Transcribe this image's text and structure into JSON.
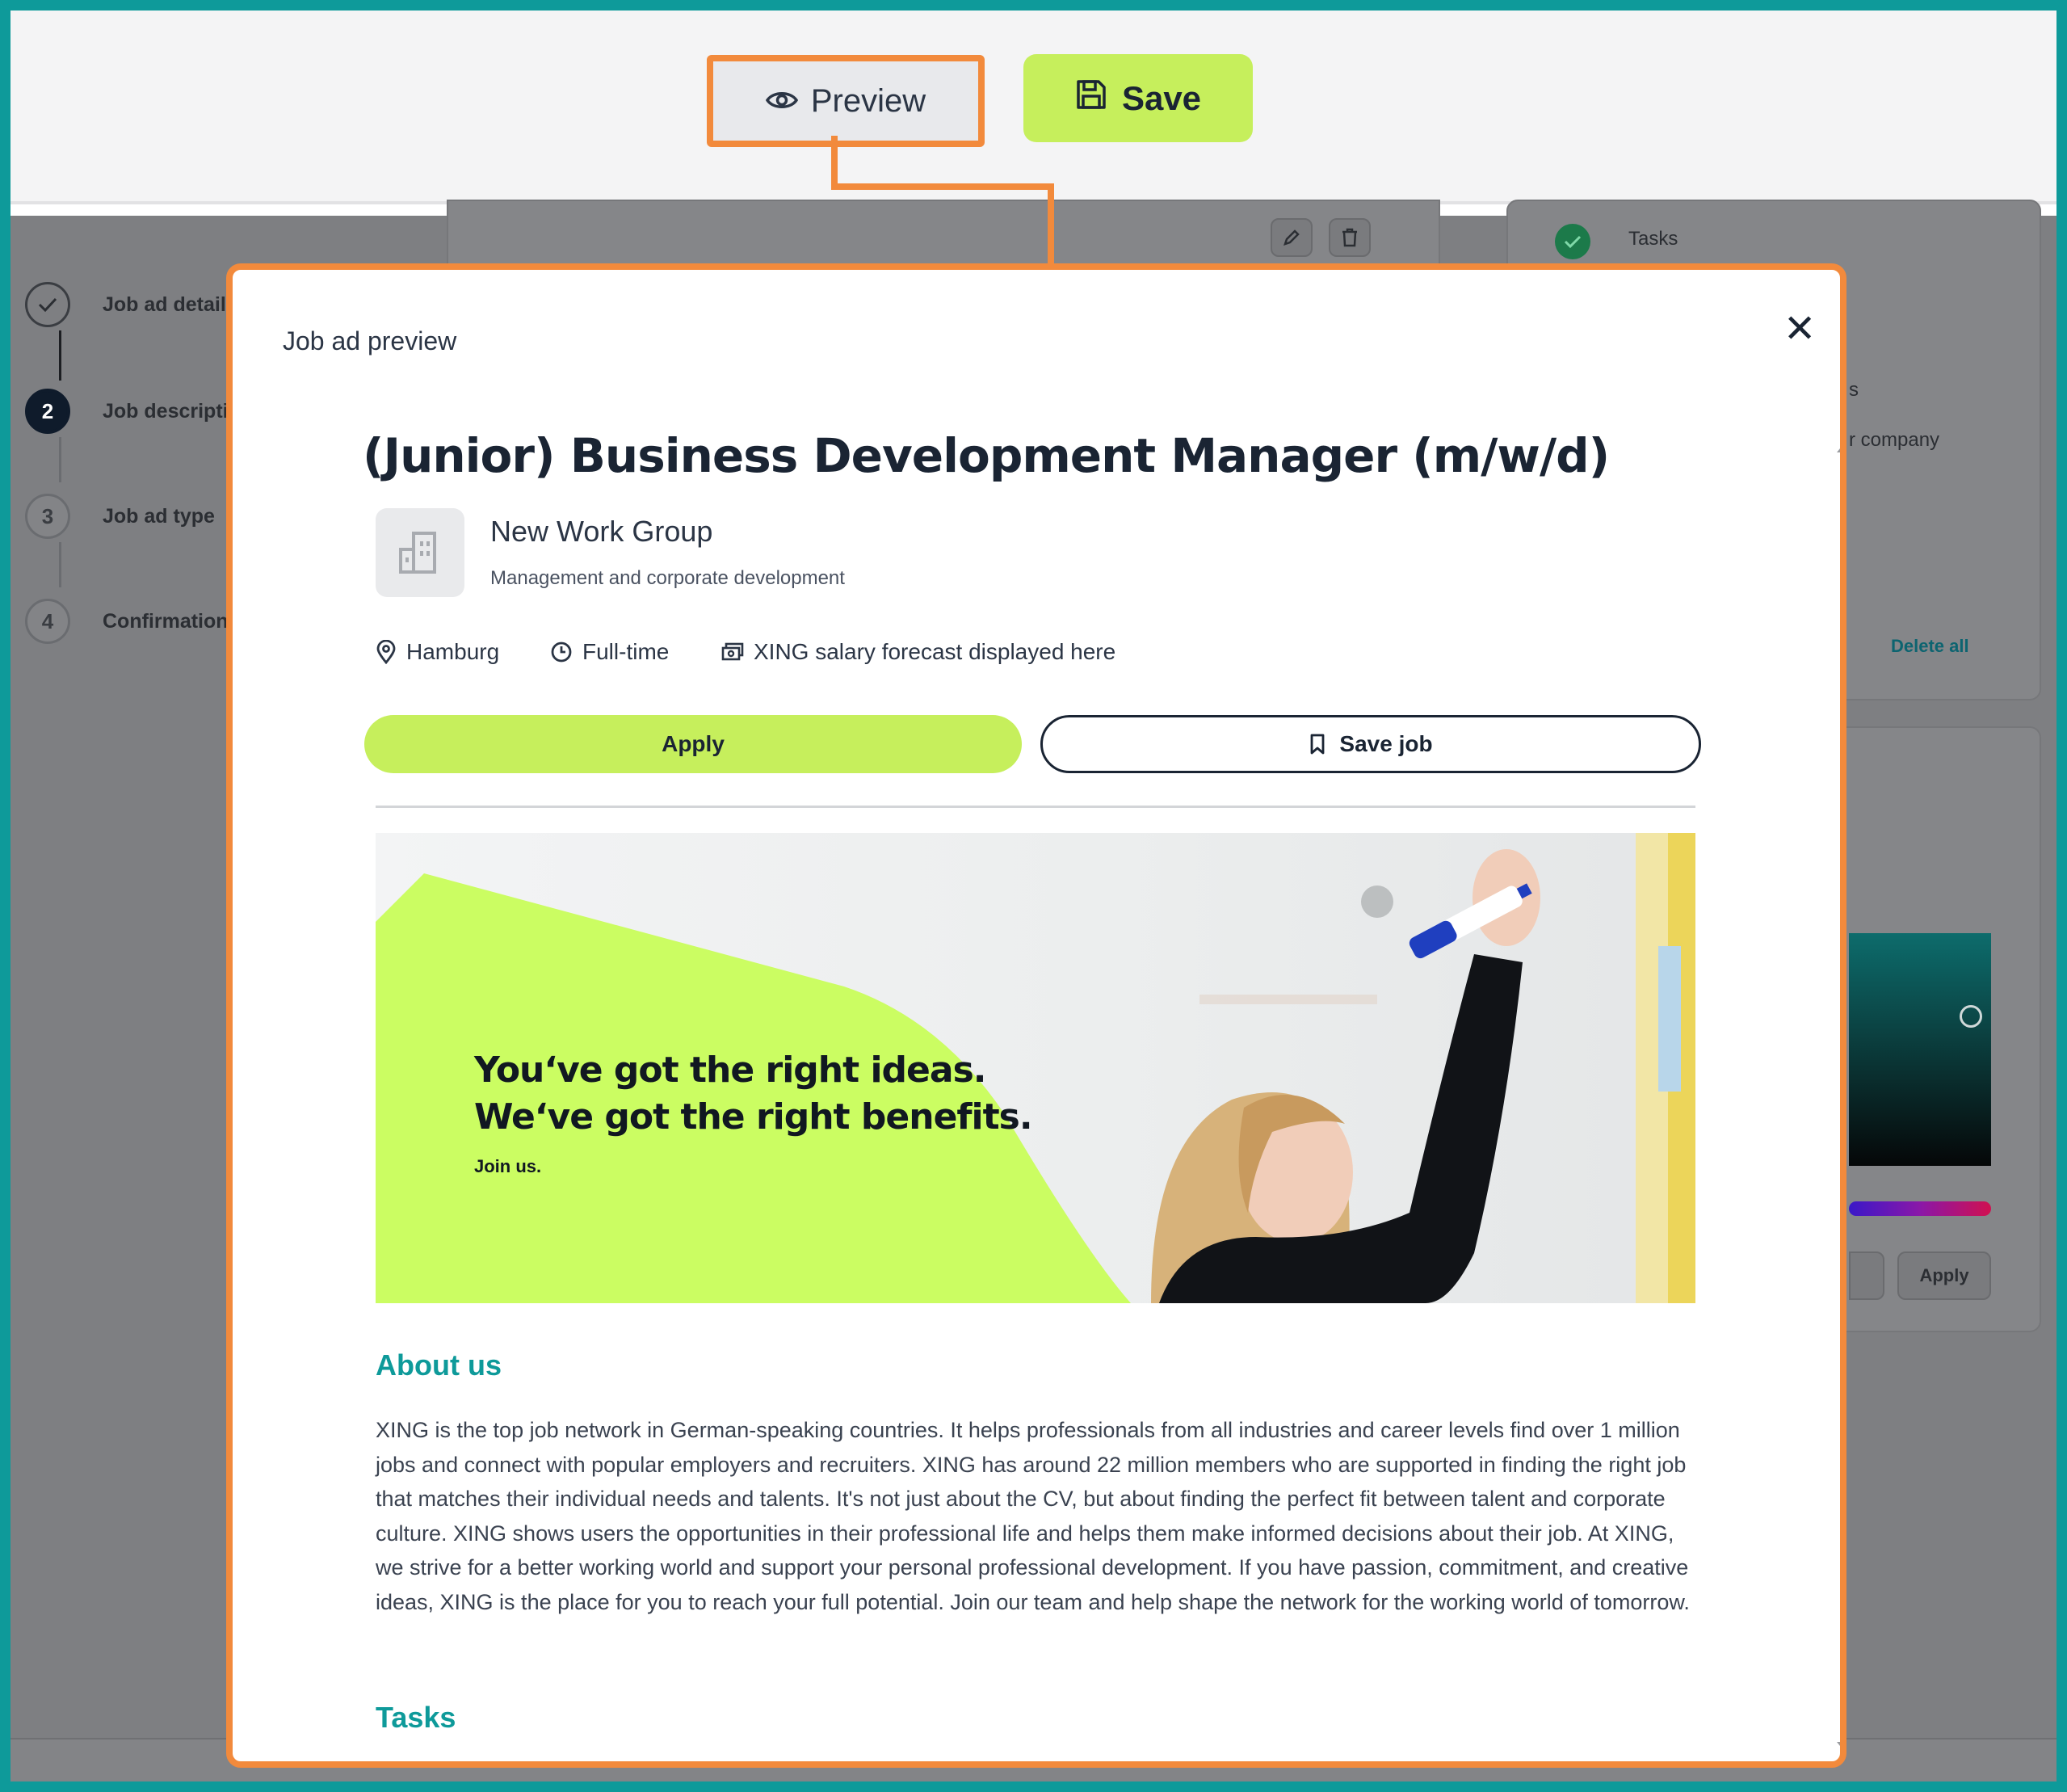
{
  "toolbar": {
    "preview_label": "Preview",
    "save_label": "Save"
  },
  "background_app": {
    "steps": [
      {
        "number": "✓",
        "label": "Job ad details"
      },
      {
        "number": "2",
        "label": "Job descriptio"
      },
      {
        "number": "3",
        "label": "Job ad type"
      },
      {
        "number": "4",
        "label": "Confirmation"
      }
    ],
    "right_panel": {
      "tasks_label": "Tasks",
      "partial_s": "s",
      "partial_company": "r company",
      "delete_all": "Delete all",
      "apply_label": "Apply"
    }
  },
  "modal": {
    "title": "Job ad preview",
    "close_glyph": "✕",
    "job": {
      "title": "(Junior) Business Development Manager (m/w/d)",
      "company_name": "New Work Group",
      "company_category": "Management and corporate development",
      "location": "Hamburg",
      "employment_type": "Full-time",
      "salary": "XING salary forecast displayed here",
      "apply_label": "Apply",
      "save_job_label": "Save job"
    },
    "banner": {
      "headline_line1": "You‘ve got the right ideas.",
      "headline_line2": "We‘ve got the right benefits.",
      "subline": "Join us."
    },
    "about": {
      "heading": "About us",
      "text": "XING is the top job network in German-speaking countries. It helps professionals from all industries and career levels find over 1 million jobs and connect with popular employers and recruiters. XING has around 22 million members who are supported in finding the right job that matches their individual needs and talents. It's not just about the CV, but about finding the perfect fit between talent and corporate culture. XING shows users the opportunities in their professional life and helps them make informed decisions about their job. At XING, we strive for a better working world and support your personal professional development. If you have passion, commitment, and creative ideas, XING is the place for you to reach your full potential. Join our team and help shape the network for the working world of tomorrow."
    },
    "tasks": {
      "heading": "Tasks"
    }
  },
  "colors": {
    "accent_orange": "#f28a3c",
    "lime": "#c6ef5c",
    "teal": "#0e9a9a",
    "navy": "#1a2433"
  }
}
